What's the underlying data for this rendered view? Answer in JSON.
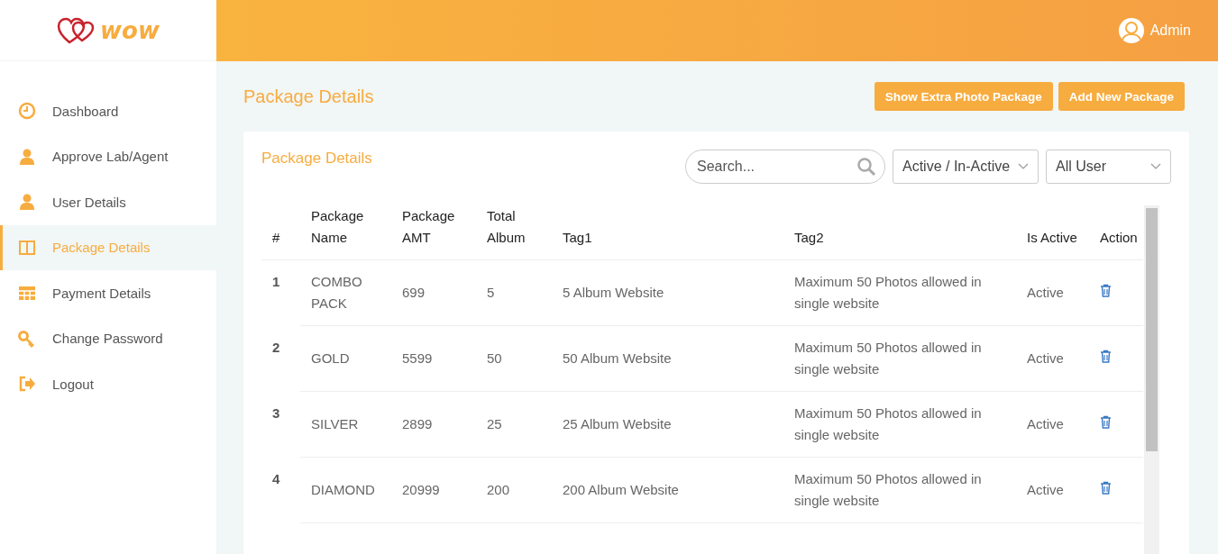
{
  "logo": {
    "text": "wow"
  },
  "header": {
    "user": "Admin"
  },
  "sidebar": {
    "items": [
      {
        "label": "Dashboard",
        "selected": false
      },
      {
        "label": "Approve Lab/Agent",
        "selected": false
      },
      {
        "label": "User Details",
        "selected": false
      },
      {
        "label": "Package Details",
        "selected": true
      },
      {
        "label": "Payment Details",
        "selected": false
      },
      {
        "label": "Change Password",
        "selected": false
      },
      {
        "label": "Logout",
        "selected": false
      }
    ]
  },
  "page": {
    "title": "Package Details",
    "buttons": [
      "Show Extra Photo Package",
      "Add New Package"
    ]
  },
  "card": {
    "title": "Package Details",
    "search": {
      "placeholder": "Search..."
    },
    "filters": [
      "Active / In-Active",
      "All User"
    ]
  },
  "table": {
    "columns": [
      "#",
      "Package Name",
      "Package AMT",
      "Total Album",
      "Tag1",
      "Tag2",
      "Is Active",
      "Action"
    ],
    "rows": [
      {
        "num": "1",
        "name": "COMBO PACK",
        "amt": "699",
        "albums": "5",
        "tag1": "5 Album Website",
        "tag2": "Maximum 50 Photos allowed in single website",
        "status": "Active"
      },
      {
        "num": "2",
        "name": "GOLD",
        "amt": "5599",
        "albums": "50",
        "tag1": "50 Album Website",
        "tag2": "Maximum 50 Photos allowed in single website",
        "status": "Active"
      },
      {
        "num": "3",
        "name": "SILVER",
        "amt": "2899",
        "albums": "25",
        "tag1": "25 Album Website",
        "tag2": "Maximum 50 Photos allowed in single website",
        "status": "Active"
      },
      {
        "num": "4",
        "name": "DIAMOND",
        "amt": "20999",
        "albums": "200",
        "tag1": "200 Album Website",
        "tag2": "Maximum 50 Photos allowed in single website",
        "status": "Active"
      }
    ]
  }
}
